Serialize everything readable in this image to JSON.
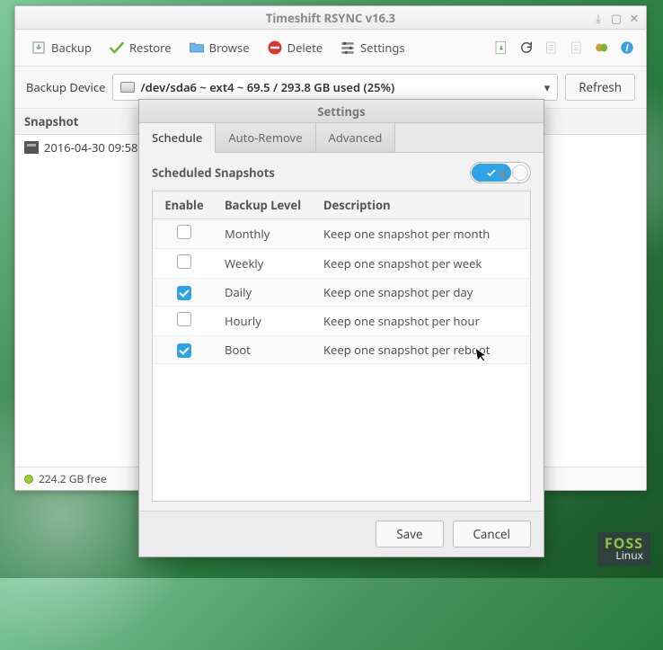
{
  "main": {
    "title": "Timeshift RSYNC v16.3",
    "toolbar": {
      "backup": "Backup",
      "restore": "Restore",
      "browse": "Browse",
      "delete": "Delete",
      "settings": "Settings"
    },
    "device": {
      "label": "Backup Device",
      "value": "/dev/sda6 ~ ext4 ~ 69.5 / 293.8 GB used (25%)",
      "refresh": "Refresh"
    },
    "list": {
      "header": "Snapshot",
      "rows": [
        "2016-04-30 09:58"
      ]
    },
    "status": {
      "free": "224.2 GB free"
    }
  },
  "dialog": {
    "title": "Settings",
    "tabs": {
      "schedule": "Schedule",
      "autoremove": "Auto-Remove",
      "advanced": "Advanced"
    },
    "scheduled_label": "Scheduled Snapshots",
    "scheduled_enabled": true,
    "cols": {
      "enable": "Enable",
      "level": "Backup Level",
      "desc": "Description"
    },
    "rows": [
      {
        "enabled": false,
        "level": "Monthly",
        "desc": "Keep one snapshot per month"
      },
      {
        "enabled": false,
        "level": "Weekly",
        "desc": "Keep one snapshot per week"
      },
      {
        "enabled": true,
        "level": "Daily",
        "desc": "Keep one snapshot per day"
      },
      {
        "enabled": false,
        "level": "Hourly",
        "desc": "Keep one snapshot per hour"
      },
      {
        "enabled": true,
        "level": "Boot",
        "desc": "Keep one snapshot per reboot"
      }
    ],
    "buttons": {
      "save": "Save",
      "cancel": "Cancel"
    }
  },
  "branding": {
    "line1": "FOSS",
    "line2": "Linux"
  }
}
